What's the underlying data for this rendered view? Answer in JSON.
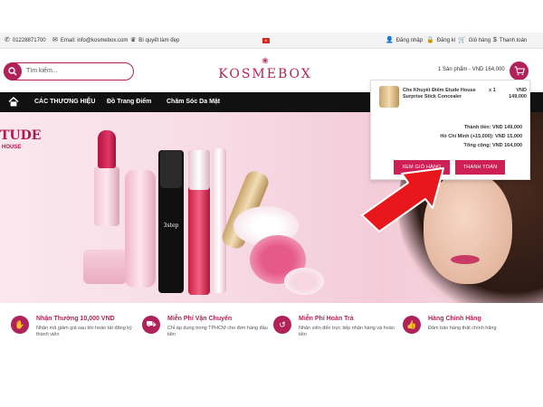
{
  "topbar": {
    "phone": "01228871700",
    "email": "Email: info@kosmebox.com",
    "beauty_tips": "Bí quyết làm đẹp",
    "login": "Đăng nhập",
    "register": "Đăng kí",
    "cart": "Giỏ hàng",
    "checkout": "Thanh toán"
  },
  "header": {
    "search_placeholder": "Tìm kiếm...",
    "logo_text": "KOSMEBOX",
    "cart_summary": "1 Sản phẩm - VND 164,000"
  },
  "nav": {
    "items": [
      "CÁC THƯƠNG HIỆU",
      "Đồ Trang Điểm",
      "Chăm Sóc Da Mặt"
    ]
  },
  "hero": {
    "brand": "TUDE",
    "brand_sub": "HOUSE",
    "mascara_label": "3step"
  },
  "cart_popup": {
    "product_name": "Che Khuyết Điểm Etude House Surprise Stick Concealer",
    "quantity": "x 1",
    "currency": "VND",
    "price": "149,000",
    "subtotal": "Thành tiền: VND 149,000",
    "shipping": "Hồ Chí Minh (+15,000): VND 15,000",
    "total": "Tổng cộng: VND 164,000",
    "view_cart_button": "XEM GIỎ HÀNG",
    "checkout_button": "THANH TOÁN"
  },
  "features": [
    {
      "title": "Nhận Thưởng 10,000 VND",
      "desc": "Nhận mã giảm giá sau khi hoàn tất đăng ký thành viên"
    },
    {
      "title": "Miễn Phí Vận Chuyển",
      "desc": "Chỉ áp dụng trong TPHCM cho đơn hàng đầu tiên"
    },
    {
      "title": "Miễn Phí Hoàn Trả",
      "desc": "Nhân viên đến trực tiếp nhận hàng và hoàn tiền"
    },
    {
      "title": "Hàng Chính Hãng",
      "desc": "Đảm bảo hàng thật chính hãng"
    }
  ],
  "colors": {
    "brand": "#b1225a",
    "button": "#cf1f57",
    "nav_bg": "#111111",
    "arrow": "#e8171b"
  }
}
